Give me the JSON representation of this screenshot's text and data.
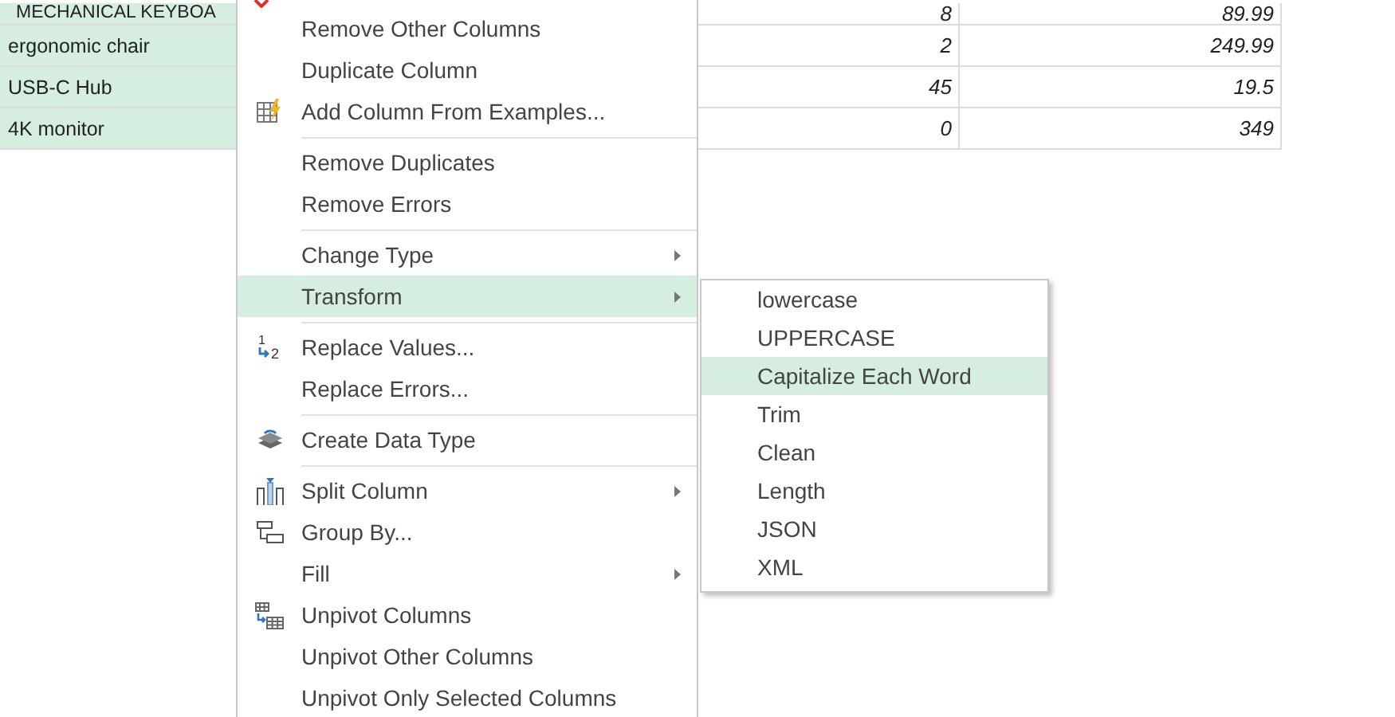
{
  "table": {
    "rows": [
      {
        "product": "MECHANICAL KEYBOA",
        "quantity": "8",
        "price": "89.99",
        "selected": true
      },
      {
        "product": "ergonomic chair",
        "quantity": "2",
        "price": "249.99",
        "selected": true
      },
      {
        "product": "USB-C Hub",
        "quantity": "45",
        "price": "19.5",
        "selected": true
      },
      {
        "product": "4K monitor",
        "quantity": "0",
        "price": "349",
        "selected": true
      }
    ]
  },
  "context_menu": {
    "groups": [
      [
        {
          "label": "Remove Other Columns",
          "submenu": false,
          "selected": false
        },
        {
          "label": "Duplicate Column",
          "submenu": false,
          "selected": false
        },
        {
          "label": "Add Column From Examples...",
          "submenu": false,
          "selected": false
        }
      ],
      [
        {
          "label": "Remove Duplicates",
          "submenu": false,
          "selected": false
        },
        {
          "label": "Remove Errors",
          "submenu": false,
          "selected": false
        }
      ],
      [
        {
          "label": "Change Type",
          "submenu": true,
          "selected": false
        },
        {
          "label": "Transform",
          "submenu": true,
          "selected": true
        }
      ],
      [
        {
          "label": "Replace Values...",
          "submenu": false,
          "selected": false,
          "icon_digits": [
            "1",
            "2"
          ]
        },
        {
          "label": "Replace Errors...",
          "submenu": false,
          "selected": false
        }
      ],
      [
        {
          "label": "Create Data Type",
          "submenu": false,
          "selected": false
        }
      ],
      [
        {
          "label": "Split Column",
          "submenu": true,
          "selected": false
        },
        {
          "label": "Group By...",
          "submenu": false,
          "selected": false
        },
        {
          "label": "Fill",
          "submenu": true,
          "selected": false
        },
        {
          "label": "Unpivot Columns",
          "submenu": false,
          "selected": false
        },
        {
          "label": "Unpivot Other Columns",
          "submenu": false,
          "selected": false
        },
        {
          "label": "Unpivot Only Selected Columns",
          "submenu": false,
          "selected": false
        }
      ]
    ]
  },
  "submenu": {
    "items": [
      {
        "label": "lowercase",
        "selected": false
      },
      {
        "label": "UPPERCASE",
        "selected": false
      },
      {
        "label": "Capitalize Each Word",
        "selected": true
      },
      {
        "label": "Trim",
        "selected": false
      },
      {
        "label": "Clean",
        "selected": false
      },
      {
        "label": "Length",
        "selected": false
      },
      {
        "label": "JSON",
        "selected": false
      },
      {
        "label": "XML",
        "selected": false
      }
    ]
  }
}
